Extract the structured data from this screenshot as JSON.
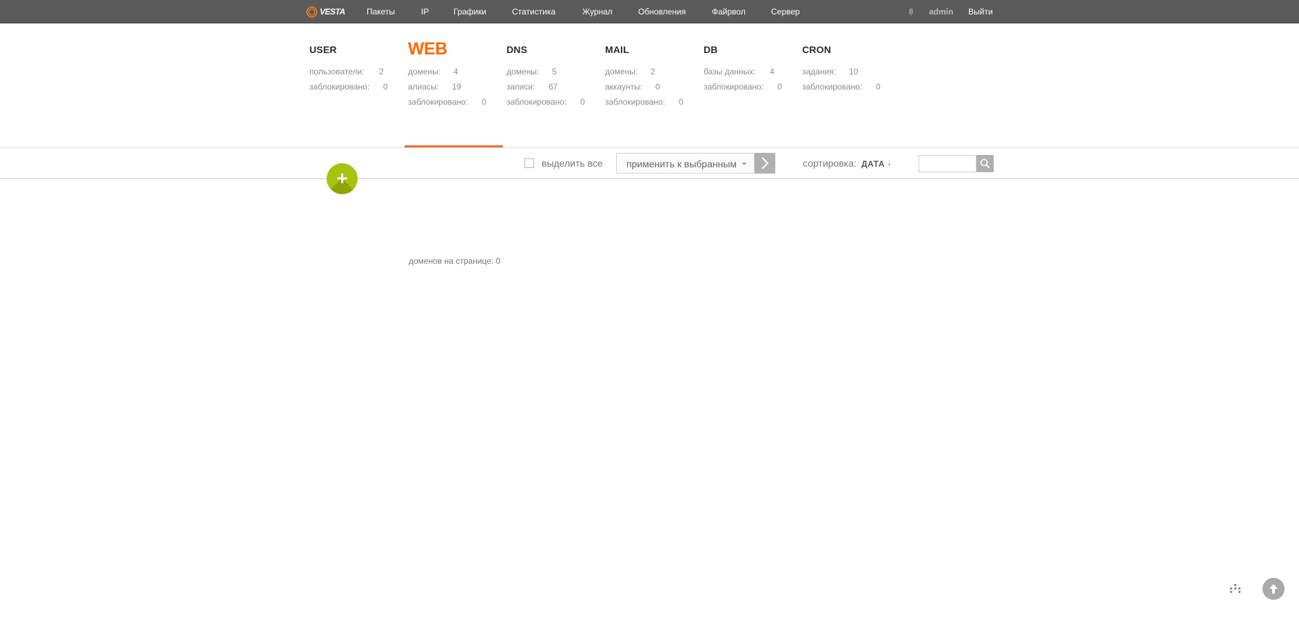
{
  "app": {
    "logo_text": "VESTA",
    "accent_color": "#ff6701",
    "topbar_color": "#5a5a5a",
    "add_button_color": "#a8c30f"
  },
  "topnav": {
    "items": [
      {
        "label": "Пакеты"
      },
      {
        "label": "IP"
      },
      {
        "label": "Графики"
      },
      {
        "label": "Статистика"
      },
      {
        "label": "Журнал"
      },
      {
        "label": "Обновления"
      },
      {
        "label": "Файрвол"
      },
      {
        "label": "Сервер"
      }
    ],
    "notifications_icon": "bell-icon",
    "user": "admin",
    "logout": "Выйти"
  },
  "stats": {
    "user": {
      "title": "USER",
      "rows": [
        {
          "label": "пользователи:",
          "value": "2"
        },
        {
          "label": "заблокировано:",
          "value": "0"
        }
      ]
    },
    "web": {
      "title": "WEB",
      "active": true,
      "rows": [
        {
          "label": "домены:",
          "value": "4"
        },
        {
          "label": "алиасы:",
          "value": "19"
        },
        {
          "label": "заблокировано:",
          "value": "0"
        }
      ]
    },
    "dns": {
      "title": "DNS",
      "rows": [
        {
          "label": "домены:",
          "value": "5"
        },
        {
          "label": "записи:",
          "value": "67"
        },
        {
          "label": "заблокировано:",
          "value": "0"
        }
      ]
    },
    "mail": {
      "title": "MAIL",
      "rows": [
        {
          "label": "домены:",
          "value": "2"
        },
        {
          "label": "аккаунты:",
          "value": "0"
        },
        {
          "label": "заблокировано:",
          "value": "0"
        }
      ]
    },
    "db": {
      "title": "DB",
      "rows": [
        {
          "label": "базы данных:",
          "value": "4"
        },
        {
          "label": "заблокировано:",
          "value": "0"
        }
      ]
    },
    "cron": {
      "title": "CRON",
      "rows": [
        {
          "label": "задания:",
          "value": "10"
        },
        {
          "label": "заблокировано:",
          "value": "0"
        }
      ]
    }
  },
  "toolbar": {
    "add_label": "+",
    "select_all_label": "выделить все",
    "select_all_checked": false,
    "apply_placeholder": "применить к выбранным",
    "sort_label": "сортировка:",
    "sort_value": "ДАТА",
    "sort_direction_icon": "arrow-down-icon",
    "search_value": "",
    "search_icon": "search-icon"
  },
  "list": {
    "domains_per_page": "доменов на странице: 0"
  },
  "footer": {
    "shortcuts_icon": "shortcuts-icon",
    "scroll_top_icon": "arrow-up-icon"
  }
}
